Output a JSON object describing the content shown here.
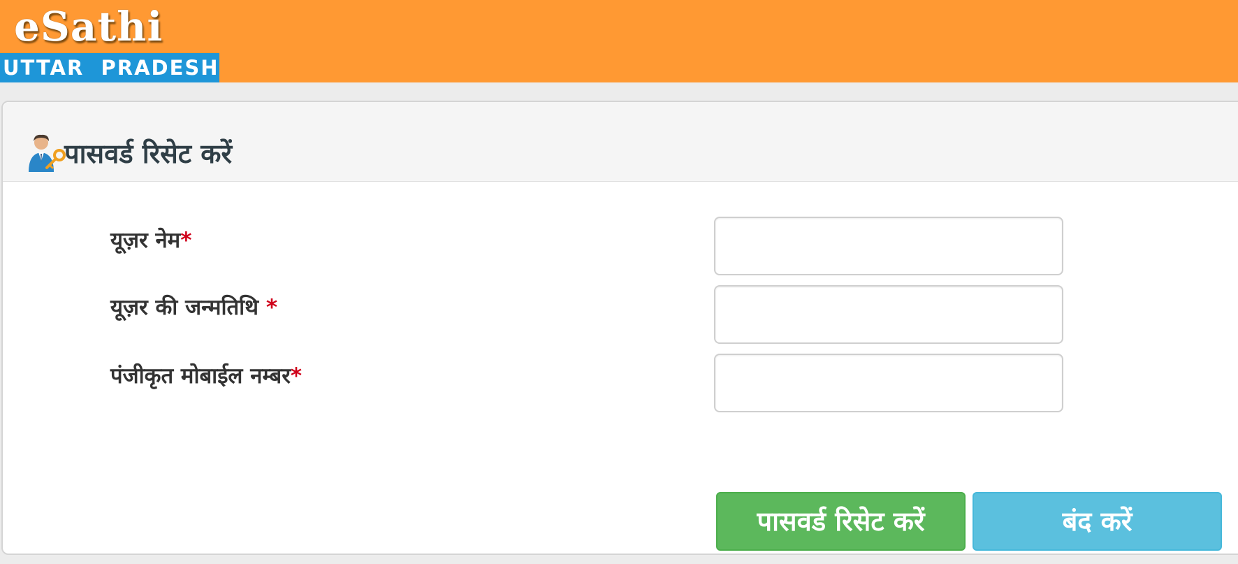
{
  "header": {
    "logo_text": "eSathi",
    "state_label": "UTTAR  PRADESH",
    "brand_color": "#ff9933",
    "state_bar_color": "#1e96d8"
  },
  "panel": {
    "icon": "user-key-icon",
    "title": "पासवर्ड रिसेट करें"
  },
  "form": {
    "username_label": "यूज़र नेम",
    "username_required": "*",
    "username_value": "",
    "dob_label": "यूज़र की जन्मतिथि ",
    "dob_required": "*",
    "dob_value": "",
    "mobile_label": "पंजीकृत मोबाईल नम्बर",
    "mobile_required": "*",
    "mobile_value": ""
  },
  "actions": {
    "reset_label": "पासवर्ड रिसेट करें",
    "reset_color": "#5cb85c",
    "close_label": "बंद करें",
    "close_color": "#5bc0de"
  }
}
